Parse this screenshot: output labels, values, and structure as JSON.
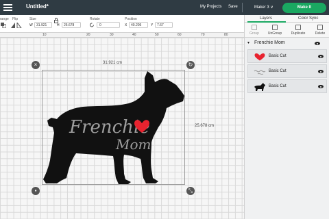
{
  "topbar": {
    "title": "Untitled*",
    "my_projects": "My Projects",
    "save": "Save",
    "machine": "Maker 3",
    "machine_arrow": "∨",
    "make_it": "Make It"
  },
  "toolbar": {
    "arrange_label": "range",
    "flip_label": "Flip",
    "size_label": "Size",
    "w_label": "W",
    "w_value": "31.921",
    "h_label": "H",
    "h_value": "25.678",
    "rotate_label": "Rotate",
    "rotate_value": "0",
    "position_label": "Position",
    "x_label": "X",
    "x_value": "40.205",
    "y_label": "Y",
    "y_value": "7.67"
  },
  "ruler": {
    "ticks": [
      "10",
      "20",
      "30",
      "40",
      "50",
      "60",
      "70",
      "80"
    ]
  },
  "canvas": {
    "width_dim": "31.921 cm",
    "height_dim": "25.678 cm",
    "text_line1": "Frenchie",
    "text_line2": "Mom",
    "heart_color": "#e8232f",
    "script_color": "#9e9e9e",
    "silhouette_color": "#111111"
  },
  "panel": {
    "tab_layers": "Layers",
    "tab_color_sync": "Color Sync",
    "tools": [
      "Group",
      "UnGroup",
      "Duplicate",
      "Delete"
    ],
    "group_name": "Frenchie Mom",
    "layers": [
      {
        "name": "Basic Cut",
        "thumb": "heart-icon"
      },
      {
        "name": "Basic Cut",
        "thumb": "script-icon"
      },
      {
        "name": "Basic Cut",
        "thumb": "dog-icon"
      }
    ]
  },
  "colors": {
    "topbar": "#2f3b43",
    "make_it": "#1aa861"
  }
}
